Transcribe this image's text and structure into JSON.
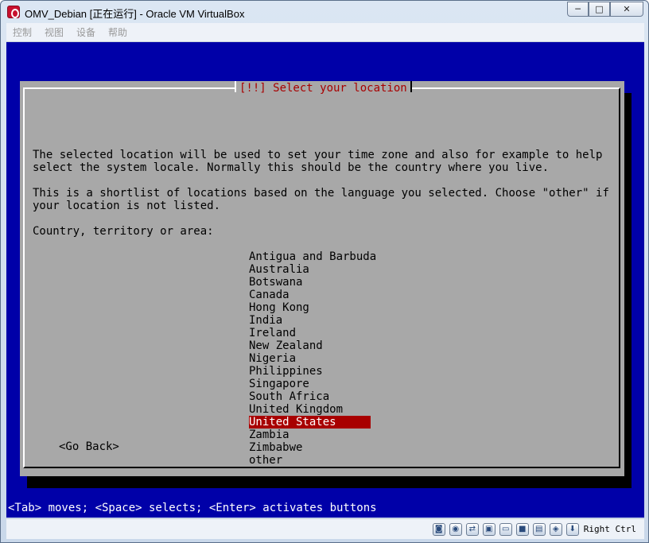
{
  "window": {
    "title": "OMV_Debian [正在运行] - Oracle VM VirtualBox",
    "buttons": {
      "minimize": "─",
      "maximize": "□",
      "close": "✕"
    }
  },
  "menubar": {
    "items": [
      "控制",
      "视图",
      "设备",
      "帮助"
    ]
  },
  "installer": {
    "title": "[!!] Select your location",
    "paragraph1": [
      "The selected location will be used to set your time zone and also for example to help",
      "select the system locale. Normally this should be the country where you live."
    ],
    "paragraph2": [
      "This is a shortlist of locations based on the language you selected. Choose \"other\" if",
      "your location is not listed."
    ],
    "prompt": "Country, territory or area:",
    "countries": [
      "Antigua and Barbuda",
      "Australia",
      "Botswana",
      "Canada",
      "Hong Kong",
      "India",
      "Ireland",
      "New Zealand",
      "Nigeria",
      "Philippines",
      "Singapore",
      "South Africa",
      "United Kingdom",
      "United States",
      "Zambia",
      "Zimbabwe",
      "other"
    ],
    "selected_index": 13,
    "go_back": "<Go Back>",
    "help": "<Tab> moves; <Space> selects; <Enter> activates buttons"
  },
  "statusbar": {
    "icons": [
      "hard-disk-icon",
      "optical-drive-icon",
      "usb-icon",
      "shared-folders-icon",
      "display-icon",
      "video-capture-icon",
      "network-icon",
      "mouse-integration-icon",
      "host-key-icon"
    ],
    "icon_glyphs": [
      "◙",
      "◉",
      "⇄",
      "▣",
      "▭",
      "■",
      "▤",
      "◈",
      "⬇"
    ],
    "host_key": "Right Ctrl"
  },
  "colors": {
    "screen_bg": "#0000a8",
    "dialog_bg": "#a8a8a8",
    "title_fg": "#a80000",
    "selection_bg": "#a80000"
  }
}
